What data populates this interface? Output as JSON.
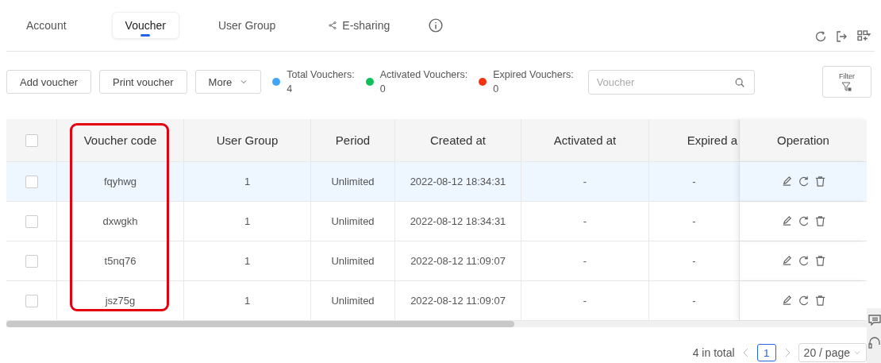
{
  "tabs": [
    {
      "label": "Account",
      "selected": false
    },
    {
      "label": "Voucher",
      "selected": true
    },
    {
      "label": "User Group",
      "selected": false
    },
    {
      "label": "E-sharing",
      "selected": false,
      "kind": "share"
    }
  ],
  "toolbar": {
    "buttons": [
      "Add voucher",
      "Print voucher"
    ],
    "more": "More"
  },
  "stats": [
    {
      "label": "Total Vouchers:",
      "value": "4",
      "color": "#3ea5f8"
    },
    {
      "label": "Activated Vouchers:",
      "value": "0",
      "color": "#0fc05a"
    },
    {
      "label": "Expired Vouchers:",
      "value": "0",
      "color": "#f5340f"
    }
  ],
  "search": {
    "placeholder": "Voucher"
  },
  "filter": {
    "label": "Filter"
  },
  "table": {
    "header_checked": false,
    "columns": [
      "Voucher code",
      "User Group",
      "Period",
      "Created at",
      "Activated at",
      "Expired a",
      "Operation"
    ],
    "rows": [
      {
        "checked": false,
        "highlighted": true,
        "cells": [
          "fqyhwg",
          "1",
          "Unlimited",
          "2022-08-12 18:34:31",
          "-",
          "-"
        ]
      },
      {
        "checked": false,
        "highlighted": false,
        "cells": [
          "dxwgkh",
          "1",
          "Unlimited",
          "2022-08-12 18:34:31",
          "-",
          "-"
        ]
      },
      {
        "checked": false,
        "highlighted": false,
        "cells": [
          "t5nq76",
          "1",
          "Unlimited",
          "2022-08-12 11:09:07",
          "-",
          "-"
        ]
      },
      {
        "checked": false,
        "highlighted": false,
        "cells": [
          "jsz75g",
          "1",
          "Unlimited",
          "2022-08-12 11:09:07",
          "-",
          "-"
        ]
      }
    ]
  },
  "pagination": {
    "total": "4 in total",
    "pages": [
      {
        "label": "1",
        "selected": true
      }
    ],
    "page_size": "20 / page"
  }
}
